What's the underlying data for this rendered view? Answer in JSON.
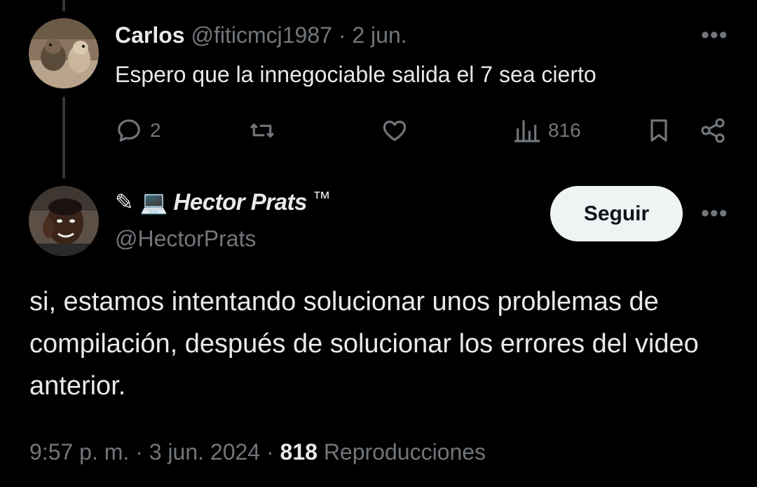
{
  "reply": {
    "name": "Carlos",
    "handle": "@fiticmcj1987",
    "separator": "·",
    "date": "2 jun.",
    "text": "Espero que la innegociable salida el 7 sea cierto",
    "more_label": "•••",
    "actions": {
      "replies": "2",
      "views": "816"
    }
  },
  "main": {
    "emoji_prefix": "✎ 💻",
    "display_name": "Hector Prats",
    "tm": "™",
    "handle": "@HectorPrats",
    "follow_label": "Seguir",
    "more_label": "•••",
    "text": "si, estamos intentando solucionar unos problemas de compilación, después de solucionar los errores del video anterior.",
    "time": "9:57 p. m.",
    "separator": "·",
    "date": "3 jun. 2024",
    "views_count": "818",
    "views_label": "Reproducciones"
  },
  "colors": {
    "background": "#000000",
    "text": "#e7e9ea",
    "secondary": "#71767b",
    "button_bg": "#eff3f4"
  }
}
